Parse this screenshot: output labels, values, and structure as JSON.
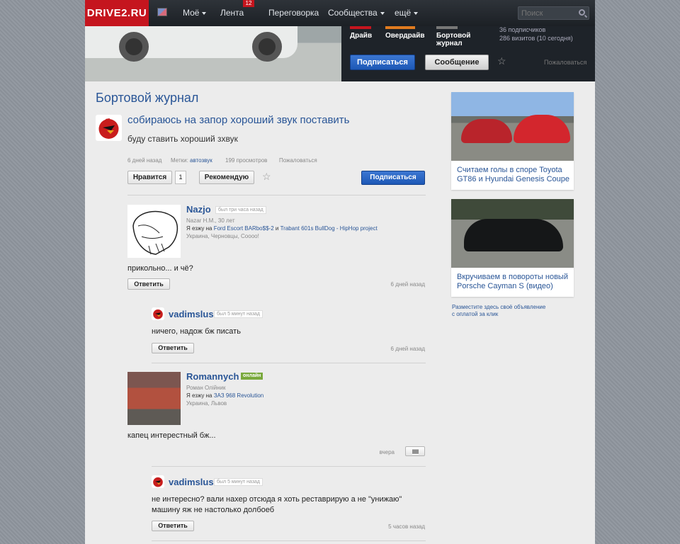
{
  "nav": {
    "logo": "DRIVE2.RU",
    "moe": "Моё",
    "lenta": "Лента",
    "lenta_badge": "12",
    "pereg": "Переговорка",
    "soobsh": "Сообщества",
    "eshche": "ещё",
    "search_placeholder": "Поиск"
  },
  "hero": {
    "cat1": "Драйв",
    "cat2": "Овердрайв",
    "cat3": "Бортовой журнал",
    "subscribers": "36 подписчиков",
    "visits": "286 визитов (10 сегодня)",
    "subscribe_btn": "Подписаться",
    "message_btn": "Сообщение",
    "complain": "Пожаловаться",
    "colors": {
      "cat1": "#c5151e",
      "cat2": "#e07b1f",
      "cat3": "#777777"
    }
  },
  "page": {
    "title": "Бортовой журнал"
  },
  "post": {
    "title": "собираюсь на запор хороший звук поставить",
    "body": "буду ставить хороший зхвук",
    "when": "6 дней назад",
    "tags_label": "Метки:",
    "tag": "автозвук",
    "views": "199 просмотров",
    "complain": "Пожаловаться",
    "like_btn": "Нравится",
    "like_count": "1",
    "recommend_btn": "Рекомендую",
    "subscribe_btn": "Подписаться"
  },
  "comments": [
    {
      "name": "Nazjo",
      "status": "был три часа назад",
      "realname": "Nazar H.M., 30 лет",
      "drive_label": "Я езжу на",
      "car1": "Ford Escort BARbo$$-2",
      "and": "и",
      "car2": "Trabant 601s BullDog - HipHop project",
      "location": "Украина, Черновцы, Сoooo!",
      "text": "прикольно... и чё?",
      "reply_btn": "Ответить",
      "ago": "6 дней назад"
    },
    {
      "name": "vadimslus",
      "status": "был 5 минут назад",
      "text": "ничего, надож бж писать",
      "reply_btn": "Ответить",
      "ago": "6 дней назад"
    },
    {
      "name": "Romannych",
      "status": "онлайн",
      "realname": "Роман Олійник",
      "drive_label": "Я езжу на",
      "car1": "ЗАЗ 968 Revolution",
      "location": "Украина, Львов",
      "text": "капец интерестный бж...",
      "ago": "вчера"
    },
    {
      "name": "vadimslus",
      "status": "был 5 минут назад",
      "text_line1": "не интересно? вали нахер отсюда я хоть реставрирую а не \"унижаю\"",
      "text_line2": "машину яж не настолько долбоеб",
      "reply_btn": "Ответить",
      "ago": "5 часов назад"
    }
  ],
  "sidebar": {
    "card1": {
      "line1": "Считаем голы в споре Toyota",
      "line2": "GT86 и Hyundai Genesis Coupe"
    },
    "card2": {
      "line1": "Вкручиваем в повороты новый",
      "line2": "Porsche Cayman S (видео)"
    },
    "ad_line1": "Разместите здесь своё объявление",
    "ad_line2": "с оплатой за клик"
  }
}
